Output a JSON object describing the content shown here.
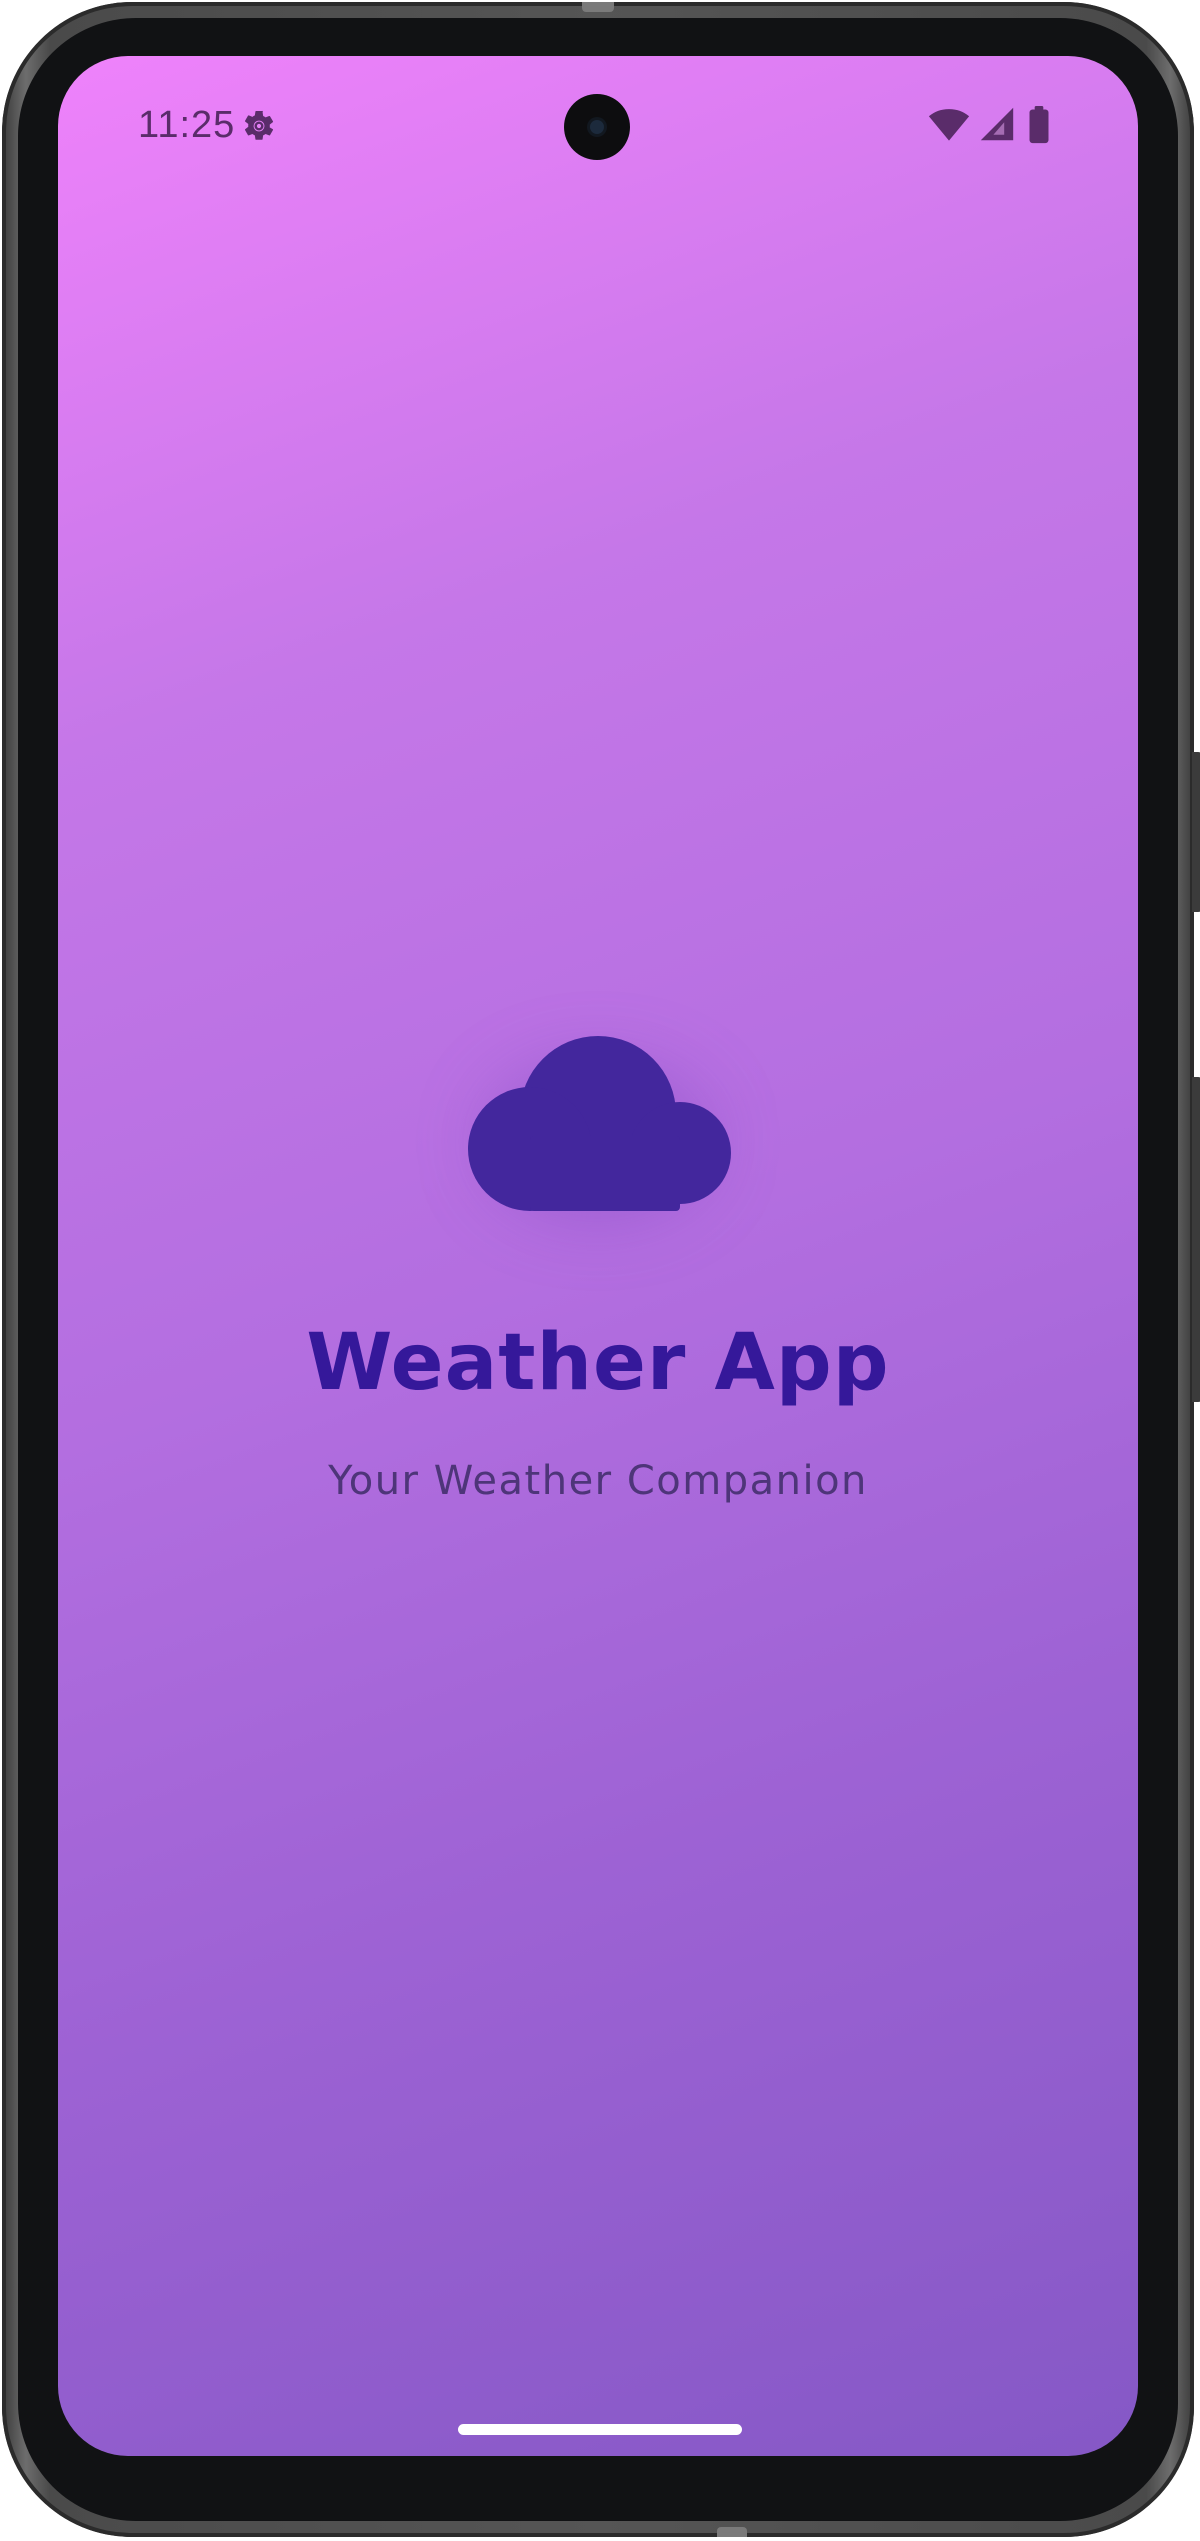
{
  "status_bar": {
    "time": "11:25",
    "icons": [
      "gear-icon",
      "wifi-icon",
      "cellular-signal-icon",
      "battery-icon"
    ],
    "icon_color": "#5a2c6a"
  },
  "splash": {
    "logo_icon": "cloud-icon",
    "title": "Weather App",
    "subtitle": "Your Weather Companion",
    "title_color": "#35189a",
    "cloud_color": "#43279d",
    "background_gradient": [
      "#ef82fb",
      "#8558c6"
    ]
  }
}
